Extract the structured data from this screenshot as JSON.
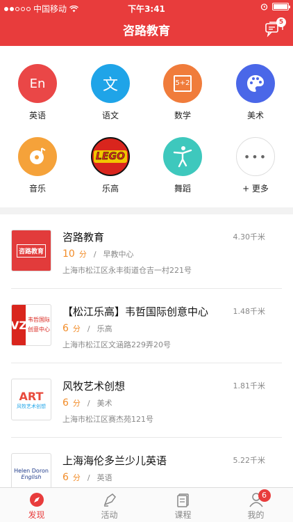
{
  "status_bar": {
    "carrier": "中国移动",
    "time": "下午3:41"
  },
  "nav": {
    "title": "咨路教育",
    "message_badge": "5"
  },
  "categories": [
    {
      "label": "英语",
      "icon": "english-icon",
      "glyph": "En",
      "color": "#ea4747"
    },
    {
      "label": "语文",
      "icon": "chinese-icon",
      "glyph": "文",
      "color": "#1fa4e8"
    },
    {
      "label": "数学",
      "icon": "math-icon",
      "glyph": "5+2",
      "color": "#f07c3b"
    },
    {
      "label": "美术",
      "icon": "palette-icon",
      "glyph": "",
      "color": "#4a67e8"
    },
    {
      "label": "音乐",
      "icon": "music-disc-icon",
      "glyph": "",
      "color": "#f5a23a"
    },
    {
      "label": "乐高",
      "icon": "lego-icon",
      "glyph": "LEGO",
      "color": "#d9251d"
    },
    {
      "label": "舞蹈",
      "icon": "dance-icon",
      "glyph": "",
      "color": "#3ec8bd"
    },
    {
      "label": "+ 更多",
      "icon": "more-icon",
      "glyph": "•••",
      "color": "#ffffff"
    }
  ],
  "listings": [
    {
      "name": "咨路教育",
      "distance": "4.30千米",
      "score": "10",
      "score_unit": "分",
      "category": "早教中心",
      "address": "上海市松江区永丰街道仓吉一村221号",
      "logo": "zilu-logo"
    },
    {
      "name": "【松江乐高】韦哲国际创意中心",
      "distance": "1.48千米",
      "score": "6",
      "score_unit": "分",
      "category": "乐高",
      "address": "上海市松江区文涵路229弄20号",
      "logo": "vz-logo"
    },
    {
      "name": "风牧艺术创想",
      "distance": "1.81千米",
      "score": "6",
      "score_unit": "分",
      "category": "美术",
      "address": "上海市松江区赛杰苑121号",
      "logo": "art-logo"
    },
    {
      "name": "上海海伦多兰少儿英语",
      "distance": "5.22千米",
      "score": "6",
      "score_unit": "分",
      "category": "英语",
      "address": "",
      "logo": "helen-doron-logo"
    }
  ],
  "logos": {
    "zilu": "咨路教育",
    "vz_title": "韦哲国际",
    "vz_sub": "创意中心",
    "art_word": "ART",
    "art_sub": "风牧艺术创想",
    "helen": "Helen Doron",
    "helen_sub": "English"
  },
  "tabs": [
    {
      "label": "发现",
      "icon": "compass-icon",
      "active": true
    },
    {
      "label": "活动",
      "icon": "activity-icon",
      "active": false
    },
    {
      "label": "课程",
      "icon": "course-icon",
      "active": false
    },
    {
      "label": "我的",
      "icon": "profile-icon",
      "active": false,
      "badge": "6"
    }
  ],
  "colors": {
    "brand": "#e83c3c",
    "score": "#f28c28"
  }
}
